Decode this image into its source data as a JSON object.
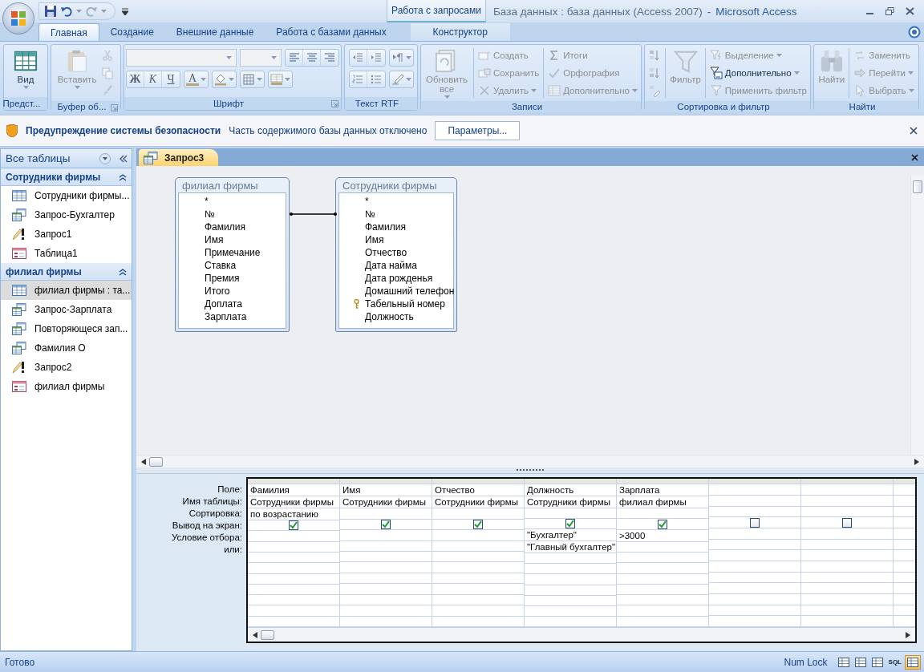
{
  "title_bar": {
    "context": "Работа с запросами",
    "document": "База данных : база данных (Access 2007)",
    "separator": "-",
    "app": "Microsoft Access"
  },
  "tabs": [
    {
      "label": "Главная",
      "selected": true,
      "contextual": false
    },
    {
      "label": "Создание",
      "selected": false,
      "contextual": false
    },
    {
      "label": "Внешние данные",
      "selected": false,
      "contextual": false
    },
    {
      "label": "Работа с базами данных",
      "selected": false,
      "contextual": false
    },
    {
      "label": "Конструктор",
      "selected": false,
      "contextual": true
    }
  ],
  "ribbon": {
    "groups": [
      {
        "label": "Предст...",
        "launcher": false,
        "items": [
          {
            "kind": "large",
            "label": "Вид",
            "disabled": false,
            "menu": true
          }
        ]
      },
      {
        "label": "Буфер об...",
        "launcher": true,
        "items": [
          {
            "kind": "large",
            "label": "Вставить",
            "disabled": true,
            "menu": true
          },
          {
            "kind": "stack",
            "entries": [
              {
                "disabled": true
              },
              {
                "disabled": true
              },
              {
                "disabled": true
              }
            ]
          }
        ]
      },
      {
        "label": "Шрифт",
        "launcher": true,
        "items": [
          {
            "kind": "toolrows",
            "rows": [
              [
                [
                  {
                    "kind": "combo"
                  }
                ],
                [
                  {
                    "kind": "combo"
                  }
                ],
                [
                  {
                    "kind": "icon"
                  },
                  {
                    "kind": "icon"
                  },
                  {
                    "kind": "icon"
                  }
                ]
              ],
              [
                [
                  {
                    "kind": "text",
                    "label": "Ж"
                  },
                  {
                    "kind": "text",
                    "label": "К"
                  },
                  {
                    "kind": "text",
                    "label": "Ч"
                  }
                ],
                [
                  {
                    "kind": "color",
                    "label": "A",
                    "menu": true
                  }
                ],
                [
                  {
                    "kind": "icon",
                    "menu": true
                  }
                ],
                [
                  {
                    "kind": "icon",
                    "menu": true
                  }
                ],
                [
                  {
                    "kind": "icon",
                    "menu": true
                  }
                ]
              ]
            ]
          }
        ]
      },
      {
        "label": "Текст RTF",
        "launcher": false,
        "items": [
          {
            "kind": "toolrows",
            "rows": [
              [
                [
                  {
                    "kind": "icon"
                  },
                  {
                    "kind": "icon"
                  }
                ],
                [
                  {
                    "kind": "icon",
                    "menu": true
                  }
                ]
              ],
              [
                [
                  {
                    "kind": "icon"
                  },
                  {
                    "kind": "icon"
                  }
                ],
                [
                  {
                    "kind": "icon",
                    "menu": true
                  }
                ]
              ]
            ]
          }
        ]
      },
      {
        "label": "Записи",
        "launcher": false,
        "items": [
          {
            "kind": "large",
            "label": "Обновить все",
            "disabled": true,
            "menu": true
          },
          {
            "kind": "stack",
            "entries": [
              {
                "label": "Создать",
                "disabled": true
              },
              {
                "label": "Сохранить",
                "disabled": true
              },
              {
                "label": "Удалить",
                "disabled": true,
                "menu": true
              }
            ]
          },
          {
            "kind": "stack",
            "entries": [
              {
                "label": "Итоги",
                "disabled": true
              },
              {
                "label": "Орфография",
                "disabled": true
              },
              {
                "label": "Дополнительно",
                "disabled": true,
                "menu": true
              }
            ]
          }
        ]
      },
      {
        "label": "Сортировка и фильтр",
        "launcher": false,
        "items": [
          {
            "kind": "stack",
            "entries": [
              {
                "disabled": true
              },
              {
                "disabled": true
              },
              {
                "disabled": true
              }
            ]
          },
          {
            "kind": "large",
            "label": "Фильтр",
            "disabled": true,
            "menu": false
          },
          {
            "kind": "stack",
            "entries": [
              {
                "label": "Выделение",
                "disabled": true,
                "menu": true
              },
              {
                "label": "Дополнительно",
                "disabled": false,
                "menu": true
              },
              {
                "label": "Применить фильтр",
                "disabled": true
              }
            ]
          }
        ]
      },
      {
        "label": "Найти",
        "launcher": false,
        "items": [
          {
            "kind": "large",
            "label": "Найти",
            "disabled": true,
            "menu": false
          },
          {
            "kind": "stack",
            "entries": [
              {
                "label": "Заменить",
                "disabled": true
              },
              {
                "label": "Перейти",
                "disabled": true,
                "menu": true
              },
              {
                "label": "Выбрать",
                "disabled": true,
                "menu": true
              }
            ]
          }
        ]
      }
    ]
  },
  "security_bar": {
    "title": "Предупреждение системы безопасности",
    "message": "Часть содержимого базы данных отключено",
    "button": "Параметры..."
  },
  "navigation": {
    "title": "Все таблицы",
    "groups": [
      {
        "title": "Сотрудники фирмы",
        "items": [
          {
            "label": "Сотрудники фирмы...",
            "kind": "table",
            "selected": false
          },
          {
            "label": "Запрос-Бухгалтер",
            "kind": "query",
            "selected": false
          },
          {
            "label": "Запрос1",
            "kind": "action",
            "selected": false
          },
          {
            "label": "Таблица1",
            "kind": "form",
            "selected": false
          }
        ]
      },
      {
        "title": "филиал фирмы",
        "items": [
          {
            "label": "филиал фирмы : та...",
            "kind": "table",
            "selected": true
          },
          {
            "label": "Запрос-Зарплата",
            "kind": "query",
            "selected": false
          },
          {
            "label": "Повторяющеся зап...",
            "kind": "query",
            "selected": false
          },
          {
            "label": "Фамилия О",
            "kind": "query",
            "selected": false
          },
          {
            "label": "Запрос2",
            "kind": "action",
            "selected": false
          },
          {
            "label": "филиал фирмы",
            "kind": "form",
            "selected": false
          }
        ]
      }
    ]
  },
  "document": {
    "tabs": [
      {
        "label": "Запрос3",
        "selected": true
      }
    ],
    "tables": [
      {
        "title": "филиал фирмы",
        "fields": [
          {
            "name": "*",
            "key": false
          },
          {
            "name": "№",
            "key": false
          },
          {
            "name": "Фамилия",
            "key": false
          },
          {
            "name": "Имя",
            "key": false
          },
          {
            "name": "Примечание",
            "key": false
          },
          {
            "name": "Ставка",
            "key": false
          },
          {
            "name": "Премия",
            "key": false
          },
          {
            "name": "Итого",
            "key": false
          },
          {
            "name": "Доплата",
            "key": false
          },
          {
            "name": "Зарплата",
            "key": false
          }
        ]
      },
      {
        "title": "Сотрудники фирмы",
        "fields": [
          {
            "name": "*",
            "key": false
          },
          {
            "name": "№",
            "key": false
          },
          {
            "name": "Фамилия",
            "key": false
          },
          {
            "name": "Имя",
            "key": false
          },
          {
            "name": "Отчество",
            "key": false
          },
          {
            "name": "Дата найма",
            "key": false
          },
          {
            "name": "Дата рожденья",
            "key": false
          },
          {
            "name": "Домашний телефон",
            "key": false
          },
          {
            "name": "Табельный номер",
            "key": true
          },
          {
            "name": "Должность",
            "key": false
          }
        ]
      }
    ],
    "grid": {
      "row_labels": [
        "Поле:",
        "Имя таблицы:",
        "Сортировка:",
        "Вывод на экран:",
        "Условие отбора:",
        "или:"
      ],
      "columns": [
        {
          "field": "Фамилия",
          "table": "Сотрудники фирмы",
          "sort": "по возрастанию",
          "show": true
        },
        {
          "field": "Имя",
          "table": "Сотрудники фирмы",
          "show": true
        },
        {
          "field": "Отчество",
          "table": "Сотрудники фирмы",
          "show": true
        },
        {
          "field": "Должность",
          "table": "Сотрудники фирмы",
          "show": true,
          "criteria": "\"Бухгалтер\"",
          "or": "\"Главный бухгалтер\""
        },
        {
          "field": "Зарплата",
          "table": "филиал фирмы",
          "show": true,
          "criteria": ">3000"
        },
        {
          "show": false
        },
        {
          "show": false
        }
      ]
    }
  },
  "status_bar": {
    "text": "Готово",
    "indicator": "Num Lock",
    "views": [
      {
        "selected": false
      },
      {
        "selected": false
      },
      {
        "selected": false
      },
      {
        "label": "SQL",
        "selected": false
      },
      {
        "selected": true
      }
    ]
  }
}
